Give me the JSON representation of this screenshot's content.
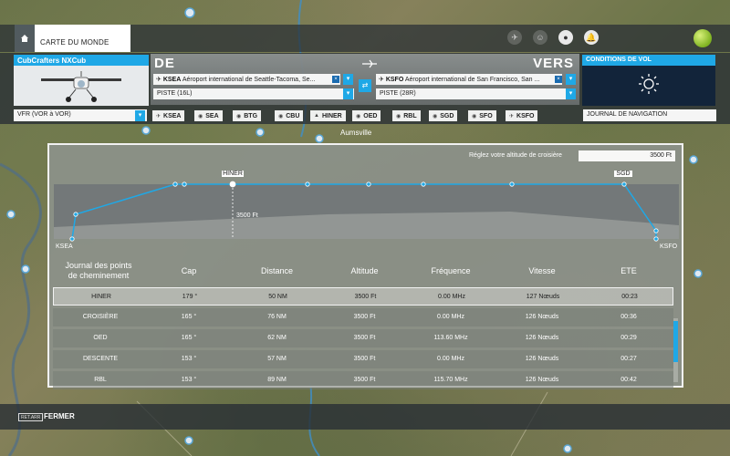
{
  "topbar": {
    "home_label": "",
    "world_tab": "CARTE DU MONDE"
  },
  "aircraft": {
    "title": "CubCrafters NXCub"
  },
  "route": {
    "from_label": "DE",
    "to_label": "VERS",
    "from_code": "KSEA",
    "from_name": "Aéroport international de Seattle-Tacoma, Se...",
    "to_code": "KSFO",
    "to_name": "Aéroport international de San Francisco, San ...",
    "from_runway": "PISTE (16L)",
    "to_runway": "PISTE (28R)"
  },
  "weather": {
    "title": "CONDITIONS DE VOL"
  },
  "nav": {
    "mode": "VFR (VOR à VOR)",
    "log_button": "JOURNAL DE NAVIGATION",
    "waypoints": [
      "KSEA",
      "SEA",
      "BTG",
      "CBU",
      "HINER",
      "OED",
      "RBL",
      "SGD",
      "SFO",
      "KSFO"
    ]
  },
  "map_labels": {
    "aumsville": "Aumsville"
  },
  "dialog": {
    "cruise_label": "Réglez votre altitude de croisière",
    "cruise_value": "3500 Ft",
    "profile": {
      "start_label": "KSEA",
      "end_label": "KSFO",
      "marker_label": "HINER",
      "marker2_label": "SGD",
      "altitude_label": "3500 Ft"
    },
    "columns": {
      "waypoint_line1": "Journal des points",
      "waypoint_line2": "de cheminement",
      "heading": "Cap",
      "distance": "Distance",
      "altitude": "Altitude",
      "frequency": "Fréquence",
      "speed": "Vitesse",
      "ete": "ETE"
    },
    "rows": [
      {
        "name": "HINER",
        "heading": "179 °",
        "distance": "50 NM",
        "altitude": "3500 Ft",
        "frequency": "0.00 MHz",
        "speed": "127 Nœuds",
        "ete": "00:23"
      },
      {
        "name": "CROISIÈRE",
        "heading": "165 °",
        "distance": "76 NM",
        "altitude": "3500 Ft",
        "frequency": "0.00 MHz",
        "speed": "126 Nœuds",
        "ete": "00:36"
      },
      {
        "name": "OED",
        "heading": "165 °",
        "distance": "62 NM",
        "altitude": "3500 Ft",
        "frequency": "113.60 MHz",
        "speed": "126 Nœuds",
        "ete": "00:29"
      },
      {
        "name": "DESCENTE",
        "heading": "153 °",
        "distance": "57 NM",
        "altitude": "3500 Ft",
        "frequency": "0.00 MHz",
        "speed": "126 Nœuds",
        "ete": "00:27"
      },
      {
        "name": "RBL",
        "heading": "153 °",
        "distance": "89 NM",
        "altitude": "3500 Ft",
        "frequency": "115.70 MHz",
        "speed": "126 Nœuds",
        "ete": "00:42"
      }
    ]
  },
  "footer": {
    "key": "RET.ARR",
    "close": "FERMER"
  },
  "colors": {
    "accent": "#1fa8e6",
    "panel": "#282e34"
  }
}
